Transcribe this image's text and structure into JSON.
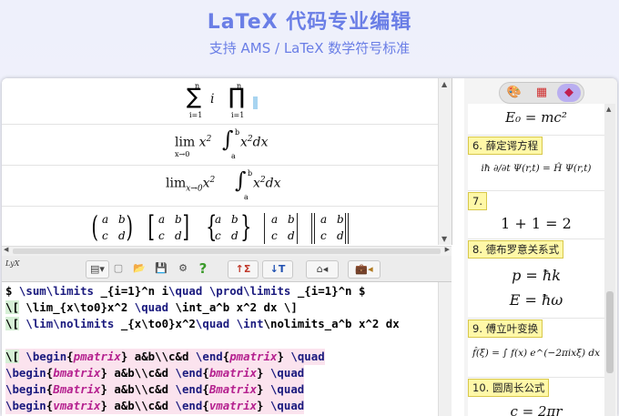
{
  "header": {
    "title": "LaTeX 代码专业编辑",
    "subtitle": "支持 AMS / LaTeX 数学符号标准"
  },
  "preview": {
    "row1_left": "∑ i",
    "row1_left_sup": "n",
    "row1_left_sub": "i=1",
    "row1_right_sup": "n",
    "row1_right_sub": "i=1",
    "row2_lim": "lim",
    "row2_lim_sub": "x→0",
    "row2_x2": "x",
    "row2_int": "∫",
    "row2_int_sup": "b",
    "row2_int_sub": "a",
    "row2_body": "x",
    "row2_dx": "dx",
    "row3_lim_sub": "x→0",
    "logo": "LyX"
  },
  "toolbar": {
    "buttons": [
      "▤▾",
      "▢",
      "📂",
      "💾",
      "⚙",
      "?",
      "↑Σ",
      "↓T",
      "⌂◂",
      "💼◂"
    ]
  },
  "editor": {
    "lines": [
      "$ \\sum\\limits _{i=1}^n i\\quad \\prod\\limits _{i=1}^n $",
      "\\[ \\lim_{x\\to0}x^2 \\quad \\int_a^b x^2 dx \\]",
      "\\[ \\lim\\nolimits _{x\\to0}x^2\\quad \\int\\nolimits_a^b x^2 dx",
      "",
      "\\[ \\begin{pmatrix} a&b\\\\c&d \\end{pmatrix} \\quad",
      "\\begin{bmatrix} a&b\\\\c&d \\end{bmatrix} \\quad",
      "\\begin{Bmatrix} a&b\\\\c&d \\end{Bmatrix} \\quad",
      "\\begin{vmatrix} a&b\\\\c&d \\end{vmatrix} \\quad"
    ]
  },
  "sidebar": {
    "tabs": [
      "paint-icon",
      "grid-icon",
      "bookmark-icon"
    ],
    "items": [
      {
        "label": "",
        "formula": "E₀ = mc²"
      },
      {
        "label": "6. 薛定谔方程",
        "formula": "iħ ∂/∂t Ψ(r,t) = Ĥ Ψ(r,t)"
      },
      {
        "label": "7.",
        "formula": "1 + 1 = 2"
      },
      {
        "label": "8. 德布罗意关系式",
        "formula": "p = ħk",
        "formula2": "E = ħω"
      },
      {
        "label": "9. 傅立叶变换",
        "formula": "f̂(ξ) = ∫ f(x) e^(−2πixξ) dx"
      },
      {
        "label": "10. 圆周长公式",
        "formula": "c = 2πr"
      }
    ]
  },
  "colors": {
    "header_text": "#6a7ee6",
    "label_bg": "#fff8a8",
    "tab_active": "#b9aef0"
  }
}
